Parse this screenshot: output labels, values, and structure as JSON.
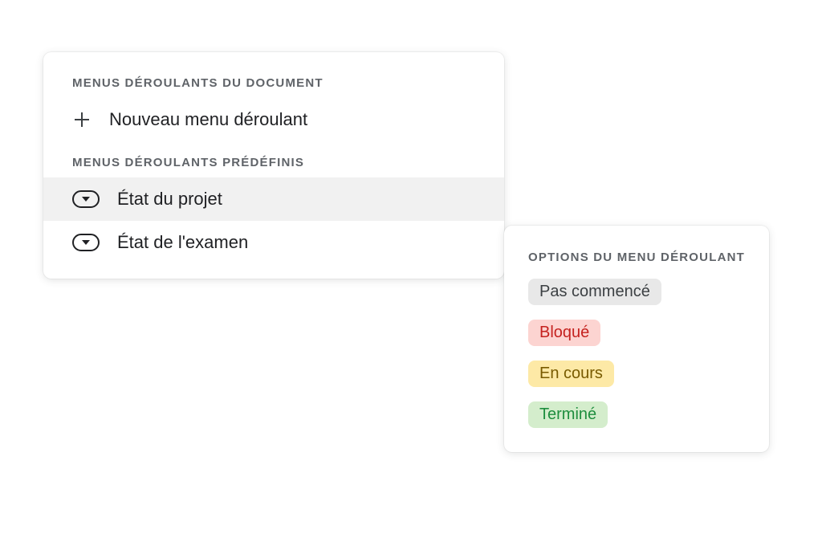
{
  "main": {
    "section1_heading": "Menus déroulants du document",
    "new_dropdown_label": "Nouveau menu déroulant",
    "section2_heading": "Menus déroulants prédéfinis",
    "preset1_label": "État du projet",
    "preset2_label": "État de l'examen"
  },
  "options": {
    "heading": "Options du menu déroulant",
    "chips": {
      "0": {
        "label": "Pas commencé",
        "bg": "#e8e8e8",
        "fg": "#3c4043"
      },
      "1": {
        "label": "Bloqué",
        "bg": "#fcd4d1",
        "fg": "#c5221f"
      },
      "2": {
        "label": "En cours",
        "bg": "#fde9a6",
        "fg": "#795b00"
      },
      "3": {
        "label": "Terminé",
        "bg": "#d4edcc",
        "fg": "#1e8e3e"
      }
    }
  }
}
